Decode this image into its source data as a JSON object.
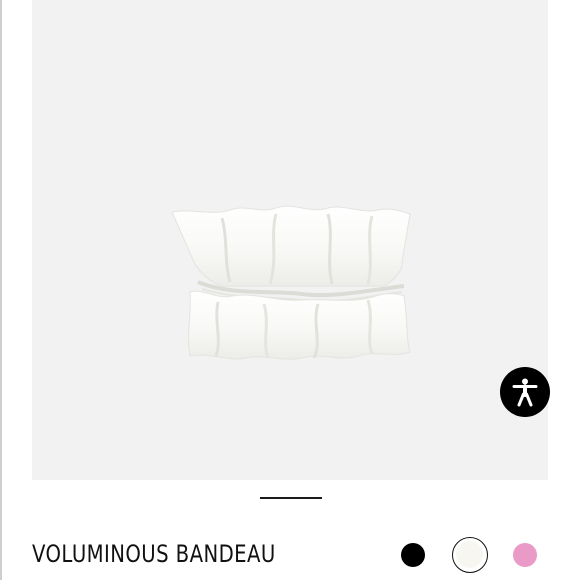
{
  "product": {
    "name": "VOLUMINOUS BANDEAU",
    "image_alt": "white voluminous ruffled bandeau top"
  },
  "gallery": {
    "active_index": 1
  },
  "colors": {
    "image_background": "#f2f2f2",
    "accent": "#000000",
    "swatches": [
      {
        "name": "black",
        "hex": "#000000",
        "selected": false
      },
      {
        "name": "white",
        "hex": "#f7f6f1",
        "selected": true
      },
      {
        "name": "pink",
        "hex": "#e99ac6",
        "selected": false
      }
    ]
  },
  "icons": {
    "accessibility": "accessibility-icon"
  }
}
